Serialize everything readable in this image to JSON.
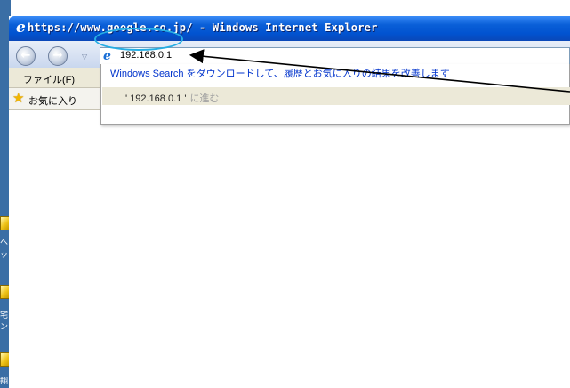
{
  "window": {
    "title": "https://www.google.co.jp/ - Windows Internet Explorer"
  },
  "address_bar": {
    "value": "192.168.0.1|"
  },
  "dropdown": {
    "windows_search_link": "Windows Search をダウンロードして、履歴とお気に入りの結果を改善します",
    "suggestion": {
      "text": "' 192.168.0.1 '",
      "hint": "に進む"
    }
  },
  "menubar": {
    "file_label": "ファイル(F)"
  },
  "favorites": {
    "label": "お気に入り"
  },
  "desktop_labels": [
    "へ",
    "ッ",
    "宅",
    "ン",
    "翔"
  ],
  "colors": {
    "annotation_ellipse": "#26aee3",
    "annotation_arrow": "#000000"
  }
}
